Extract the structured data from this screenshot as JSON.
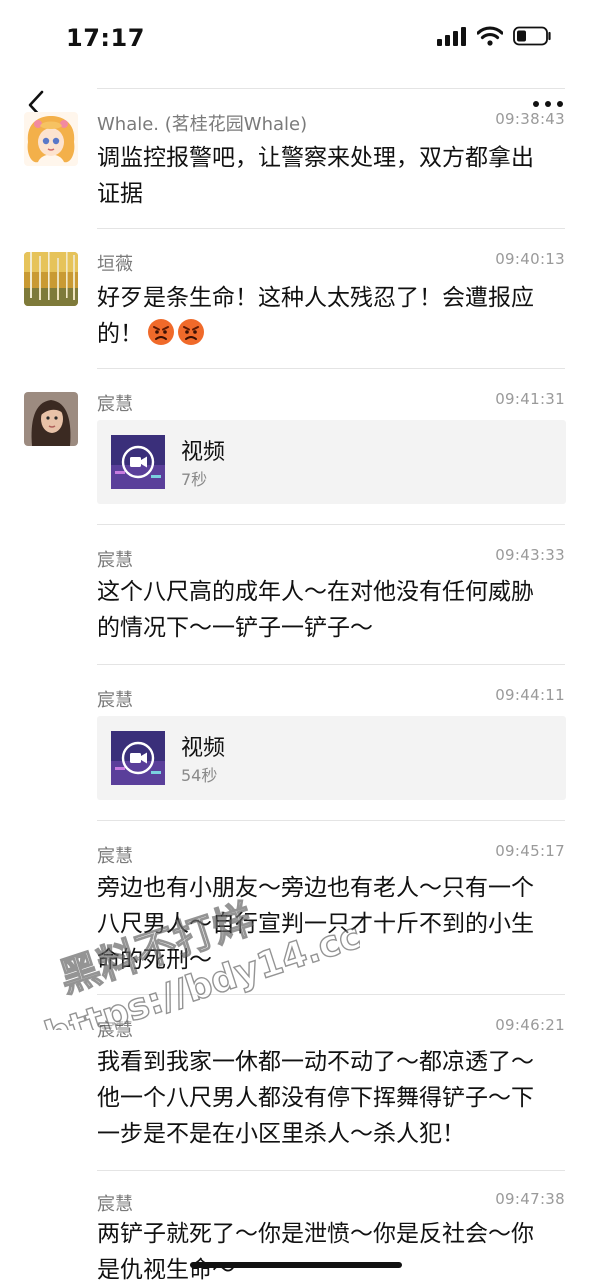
{
  "status_bar": {
    "time": "17:17"
  },
  "messages": [
    {
      "name": "Whale. (茗桂花园Whale)",
      "time": "09:38:43",
      "text": "调监控报警吧，让警察来处理，双方都拿出证据"
    },
    {
      "name": "垣薇",
      "time": "09:40:13",
      "text": "好歹是条生命！这种人太残忍了！会遭报应的！",
      "emojis": [
        "angry-face",
        "angry-face"
      ]
    },
    {
      "name": "宸慧",
      "time": "09:41:31",
      "video": {
        "title": "视频",
        "duration": "7秒"
      }
    },
    {
      "name": "宸慧",
      "time": "09:43:33",
      "text": "这个八尺高的成年人～在对他没有任何威胁的情况下～一铲子一铲子～"
    },
    {
      "name": "宸慧",
      "time": "09:44:11",
      "video": {
        "title": "视频",
        "duration": "54秒"
      }
    },
    {
      "name": "宸慧",
      "time": "09:45:17",
      "text": "旁边也有小朋友～旁边也有老人～只有一个八尺男人～自行宣判一只才十斤不到的小生命的死刑～"
    },
    {
      "name": "宸慧",
      "time": "09:46:21",
      "text": "我看到我家一休都一动不动了～都凉透了～他一个八尺男人都没有停下挥舞得铲子～下一步是不是在小区里杀人～杀人犯！"
    },
    {
      "name": "宸慧",
      "time": "09:47:38",
      "text": "两铲子就死了～你是泄愤～你是反社会～你是仇视生命～"
    }
  ],
  "watermark": {
    "line1": "黑料不打烊",
    "line2": "https://bdy14.cc"
  },
  "colors": {
    "accent_video_bg": "#3a2f7a",
    "divider": "#e4e4e4",
    "meta_text": "#9a9a9a"
  }
}
